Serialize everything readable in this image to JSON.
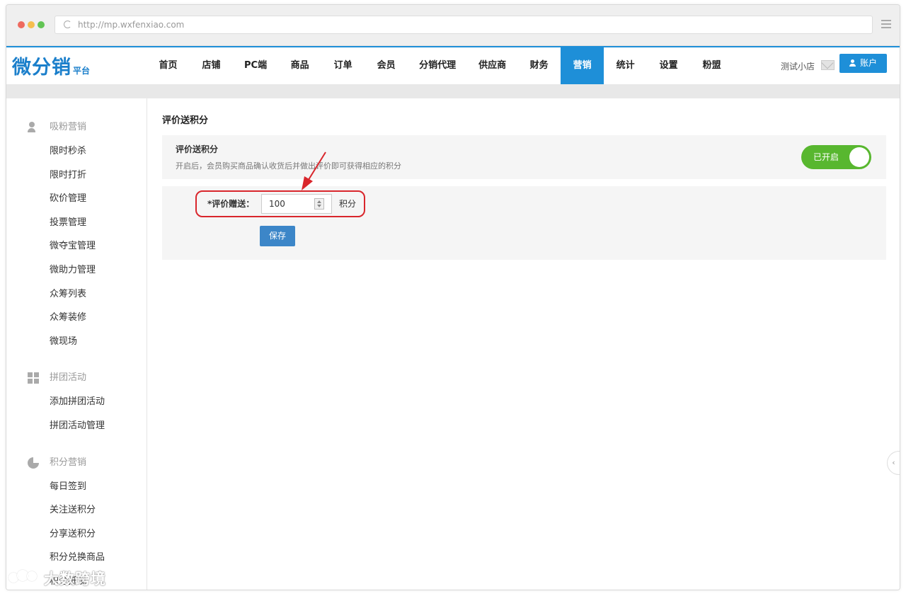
{
  "browser": {
    "url": "http://mp.wxfenxiao.com"
  },
  "brand": {
    "logo_main": "微分销",
    "logo_sub": "平台"
  },
  "nav": {
    "items": [
      {
        "label": "首页"
      },
      {
        "label": "店铺"
      },
      {
        "label": "PC端"
      },
      {
        "label": "商品"
      },
      {
        "label": "订单"
      },
      {
        "label": "会员"
      },
      {
        "label": "分销代理"
      },
      {
        "label": "供应商"
      },
      {
        "label": "财务"
      },
      {
        "label": "营销",
        "active": true
      },
      {
        "label": "统计"
      },
      {
        "label": "设置"
      },
      {
        "label": "粉盟"
      }
    ],
    "shop_name": "测试小店",
    "account_label": "账户",
    "accent_color": "#1e8fd8"
  },
  "sidebar": {
    "groups": [
      {
        "title": "吸粉营销",
        "icon": "user-add-icon",
        "items": [
          "限时秒杀",
          "限时打折",
          "砍价管理",
          "投票管理",
          "微夺宝管理",
          "微助力管理",
          "众筹列表",
          "众筹装修",
          "微现场"
        ]
      },
      {
        "title": "拼团活动",
        "icon": "grid-icon",
        "items": [
          "添加拼团活动",
          "拼团活动管理"
        ]
      },
      {
        "title": "积分营销",
        "icon": "pie-icon",
        "items": [
          "每日签到",
          "关注送积分",
          "分享送积分",
          "积分兑换商品",
          "积分抵现"
        ]
      }
    ]
  },
  "main": {
    "page_title": "评价送积分",
    "toggle_panel": {
      "title": "评价送积分",
      "description": "开启后，会员购买商品确认收货后并做出评价即可获得相应的积分",
      "switch_label": "已开启",
      "switch_on": true,
      "switch_color": "#58b72f"
    },
    "form": {
      "label": "*评价赠送：",
      "value": "100",
      "unit": "积分",
      "save_label": "保存"
    },
    "highlight_color": "#d9262c"
  },
  "watermark": {
    "text": "大数跨境"
  }
}
